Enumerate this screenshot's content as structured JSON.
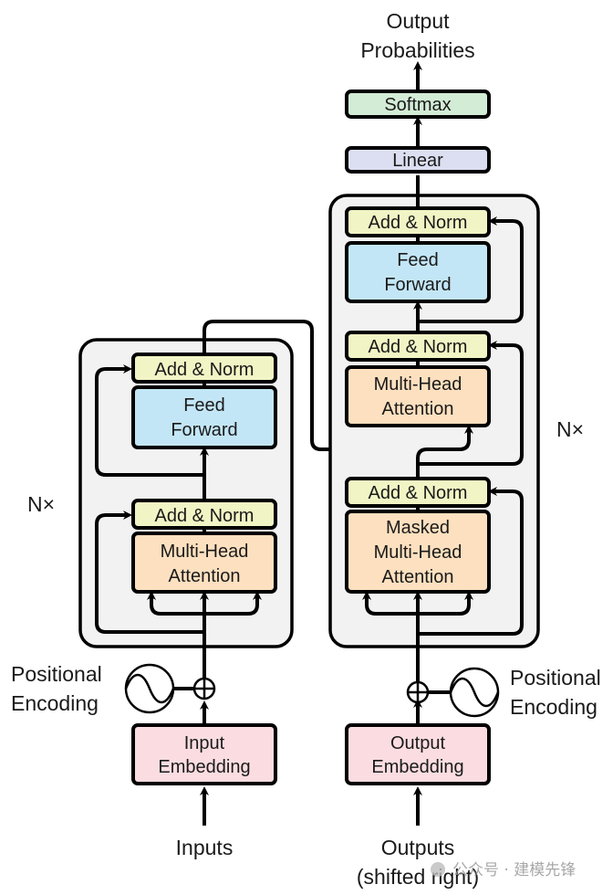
{
  "colors": {
    "add_norm": "#f1f4c4",
    "feed_forward": "#c3e6f6",
    "attention": "#fde0bf",
    "embedding": "#fbdde1",
    "linear": "#dcdff1",
    "softmax": "#d3ecd6",
    "container": "#f2f2f2"
  },
  "encoder": {
    "repeat_label": "N×",
    "add_norm_top": "Add & Norm",
    "feed_forward": [
      "Feed",
      "Forward"
    ],
    "add_norm_bottom": "Add & Norm",
    "attention": [
      "Multi-Head",
      "Attention"
    ],
    "positional_encoding": [
      "Positional",
      "Encoding"
    ],
    "embedding": [
      "Input",
      "Embedding"
    ],
    "input_label": "Inputs"
  },
  "decoder": {
    "repeat_label": "N×",
    "add_norm_top": "Add & Norm",
    "feed_forward": [
      "Feed",
      "Forward"
    ],
    "add_norm_mid": "Add & Norm",
    "cross_attention": [
      "Multi-Head",
      "Attention"
    ],
    "add_norm_bottom": "Add & Norm",
    "masked_attention": [
      "Masked",
      "Multi-Head",
      "Attention"
    ],
    "positional_encoding": [
      "Positional",
      "Encoding"
    ],
    "embedding": [
      "Output",
      "Embedding"
    ],
    "input_label": [
      "Outputs",
      "(shifted right)"
    ]
  },
  "head": {
    "linear": "Linear",
    "softmax": "Softmax",
    "output_label": [
      "Output",
      "Probabilities"
    ]
  },
  "watermark": "公众号 · 建模先锋"
}
